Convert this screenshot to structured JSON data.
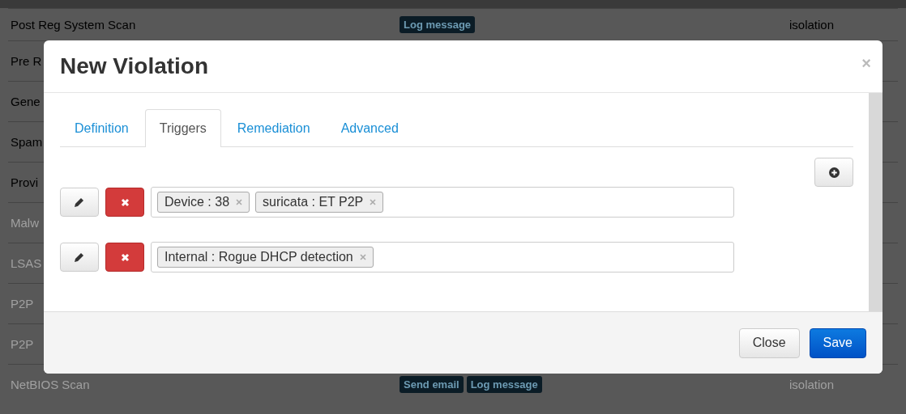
{
  "background_table": {
    "rows": [
      {
        "name": "Post Reg System Scan",
        "enabled": true,
        "actions": [
          "Log message"
        ],
        "type": "isolation"
      },
      {
        "name": "Pre R",
        "enabled": true,
        "actions": [],
        "type": ""
      },
      {
        "name": "Gene",
        "enabled": true,
        "actions": [],
        "type": ""
      },
      {
        "name": "Spam",
        "enabled": true,
        "actions": [],
        "type": ""
      },
      {
        "name": "Provi",
        "enabled": true,
        "actions": [],
        "type": ""
      },
      {
        "name": "Malw",
        "enabled": false,
        "actions": [],
        "type": ""
      },
      {
        "name": "LSAS",
        "enabled": false,
        "actions": [],
        "type": ""
      },
      {
        "name": "P2P",
        "enabled": false,
        "actions": [],
        "type": ""
      },
      {
        "name": "P2P",
        "enabled": false,
        "actions": [],
        "type": ""
      },
      {
        "name": "NetBIOS Scan",
        "enabled": false,
        "actions": [
          "Send email",
          "Log message"
        ],
        "type": "isolation"
      }
    ]
  },
  "modal": {
    "title": "New Violation",
    "close_icon": "×",
    "tabs": [
      {
        "label": "Definition",
        "selected": false
      },
      {
        "label": "Triggers",
        "selected": true
      },
      {
        "label": "Remediation",
        "selected": false
      },
      {
        "label": "Advanced",
        "selected": false
      }
    ],
    "triggers": [
      {
        "tags": [
          "Device : 38",
          "suricata : ET P2P"
        ]
      },
      {
        "tags": [
          "Internal : Rogue DHCP detection"
        ]
      }
    ],
    "buttons": [
      {
        "label": "Close",
        "kind": "default"
      },
      {
        "label": "Save",
        "kind": "primary"
      }
    ]
  }
}
